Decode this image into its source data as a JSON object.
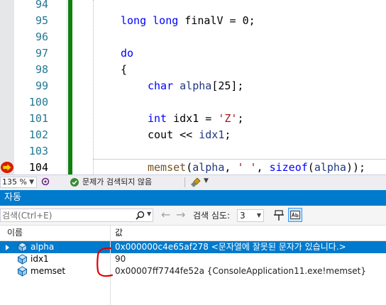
{
  "editor": {
    "line_numbers": [
      "94",
      "95",
      "96",
      "97",
      "98",
      "99",
      "100",
      "101",
      "102",
      "103",
      "104"
    ],
    "current_line": "104",
    "code": {
      "l95": {
        "kw": "long long",
        "rest": " finalV = 0;"
      },
      "l97": {
        "kw": "do"
      },
      "l98": {
        "text": "{"
      },
      "l99": {
        "kw": "char",
        "var": " alpha",
        "rest": "[25];"
      },
      "l101": {
        "kw": "int",
        "rest1": " idx1 = ",
        "str": "'Z'",
        "rest2": ";"
      },
      "l102": {
        "rest1": "cout << ",
        "var": "idx1",
        "rest2": ";"
      },
      "l104": {
        "fn": "memset",
        "p1": "(",
        "var1": "alpha",
        "p2": ", ",
        "str": "' '",
        "p3": ", ",
        "kw": "sizeof",
        "p4": "(",
        "var2": "alpha",
        "p5": "));"
      }
    }
  },
  "status_bar": {
    "zoom": "135 %",
    "issues_text": "문제가 검색되지 않음"
  },
  "autos": {
    "title": "자동",
    "search_placeholder": "검색(Ctrl+E)",
    "depth_label": "검색 심도:",
    "depth_value": "3",
    "col_name": "이름",
    "col_value": "값",
    "rows": [
      {
        "name": "alpha",
        "value": "0x000000c4e65af278 <문자열에 잘못된 문자가 있습니다.>"
      },
      {
        "name": "idx1",
        "value": "90"
      },
      {
        "name": "memset",
        "value": "0x00007ff7744fe52a {ConsoleApplication11.exe!memset}"
      }
    ]
  },
  "colors": {
    "accent": "#007acc",
    "change_bar": "#108010",
    "annotation": "#e00000"
  }
}
